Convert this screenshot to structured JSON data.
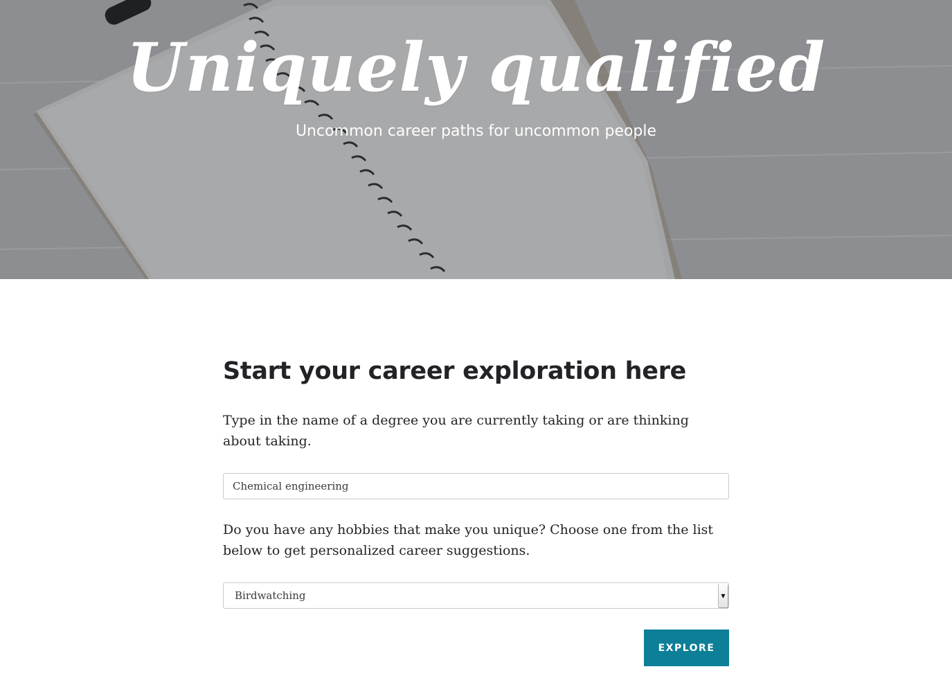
{
  "hero": {
    "title": "Uniquely qualified",
    "subtitle": "Uncommon career paths for uncommon people"
  },
  "form": {
    "heading": "Start your career exploration here",
    "degree_prompt": "Type in the name of a degree you are currently taking or are thinking about taking.",
    "degree_value": "Chemical engineering",
    "hobby_prompt": "Do you have any hobbies that make you unique? Choose one from the list below to get personalized career suggestions.",
    "hobby_selected": "Birdwatching",
    "explore_label": "EXPLORE"
  },
  "colors": {
    "accent": "#0d7f98",
    "heading_text": "#222326",
    "hero_overlay": "#8a8b8e"
  },
  "icons": {
    "select_arrow": "chevron-down-icon"
  }
}
